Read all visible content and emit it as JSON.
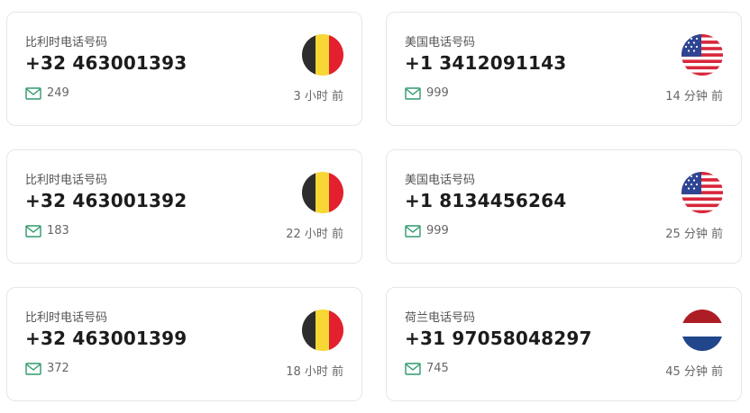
{
  "cards": [
    {
      "country": "比利时电话号码",
      "number": "+32 463001393",
      "sms_count": "249",
      "time": "3 小时 前",
      "flag_icon": "belgium-flag-icon"
    },
    {
      "country": "美国电话号码",
      "number": "+1 3412091143",
      "sms_count": "999",
      "time": "14 分钟 前",
      "flag_icon": "usa-flag-icon"
    },
    {
      "country": "比利时电话号码",
      "number": "+32 463001392",
      "sms_count": "183",
      "time": "22 小时 前",
      "flag_icon": "belgium-flag-icon"
    },
    {
      "country": "美国电话号码",
      "number": "+1 8134456264",
      "sms_count": "999",
      "time": "25 分钟 前",
      "flag_icon": "usa-flag-icon"
    },
    {
      "country": "比利时电话号码",
      "number": "+32 463001399",
      "sms_count": "372",
      "time": "18 小时 前",
      "flag_icon": "belgium-flag-icon"
    },
    {
      "country": "荷兰电话号码",
      "number": "+31 97058048297",
      "sms_count": "745",
      "time": "45 分钟 前",
      "flag_icon": "netherlands-flag-icon"
    }
  ],
  "colors": {
    "mail_icon": "#2e9a6b",
    "belgium": [
      "#2d2d2d",
      "#f6d735",
      "#e3202e"
    ],
    "usa_red": "#d8263a",
    "usa_blue": "#2e4593",
    "netherlands": [
      "#ad1d25",
      "#ffffff",
      "#21468b"
    ]
  }
}
